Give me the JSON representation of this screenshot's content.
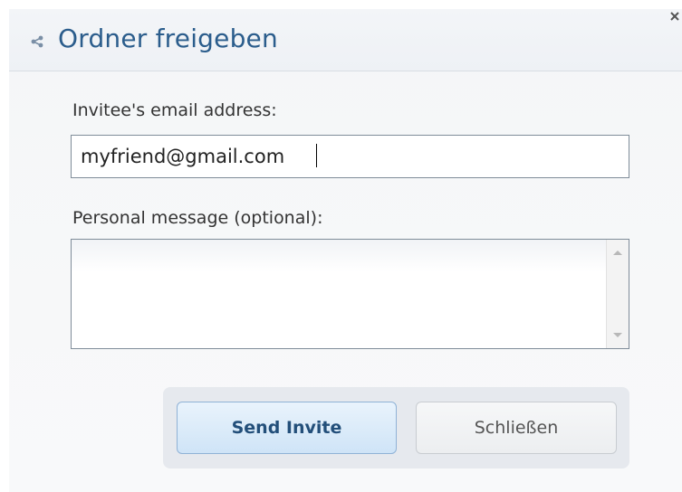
{
  "dialog": {
    "title": "Ordner freigeben",
    "close_icon": "close-icon",
    "share_icon": "share-icon"
  },
  "form": {
    "email_label": "Invitee's email address:",
    "email_value": "myfriend@gmail.com",
    "message_label": "Personal message (optional):",
    "message_value": ""
  },
  "buttons": {
    "send_label": "Send Invite",
    "close_label": "Schließen"
  },
  "colors": {
    "title": "#2b5d8c",
    "send_button_bg": "#cfe4f7",
    "send_button_text": "#234f7a"
  }
}
